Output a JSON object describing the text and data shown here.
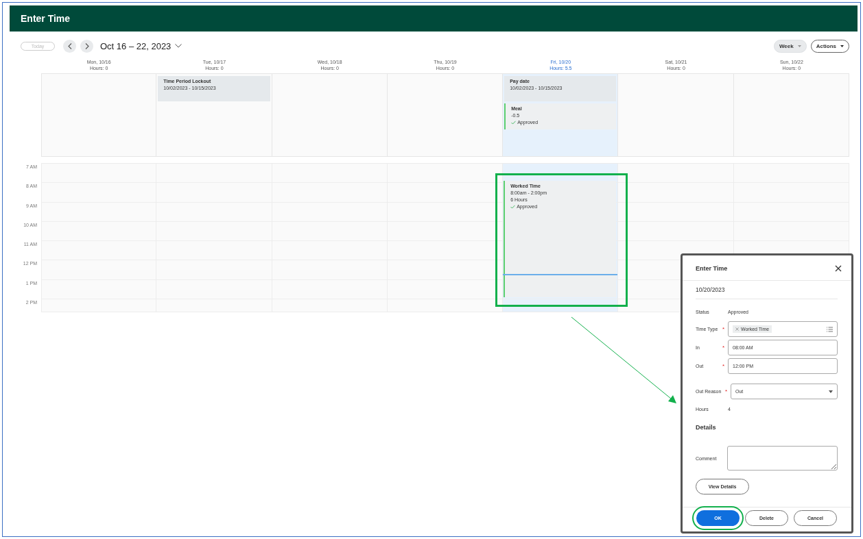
{
  "header": {
    "title": "Enter Time"
  },
  "toolbar": {
    "today": {
      "label": "Today",
      "disabled": true
    },
    "range": "Oct 16 – 22, 2023",
    "view": "Week",
    "actions": "Actions"
  },
  "days": [
    {
      "label": "Mon, 10/16",
      "hours": "Hours: 0",
      "selected": false
    },
    {
      "label": "Tue, 10/17",
      "hours": "Hours: 0",
      "selected": false,
      "all_day": [
        {
          "title": "Time Period Lockout",
          "lines": [
            "10/02/2023 - 10/15/2023"
          ],
          "approved": false
        }
      ]
    },
    {
      "label": "Wed, 10/18",
      "hours": "Hours: 0",
      "selected": false
    },
    {
      "label": "Thu, 10/19",
      "hours": "Hours: 0",
      "selected": false
    },
    {
      "label": "Fri, 10/20",
      "hours": "Hours: 5.5",
      "selected": true,
      "all_day": [
        {
          "title": "Pay date",
          "lines": [
            "10/02/2023 - 10/15/2023"
          ],
          "approved": false
        },
        {
          "title": "Meal",
          "lines": [
            "-0.5"
          ],
          "approved": true,
          "status": "Approved"
        }
      ],
      "timed": [
        {
          "title": "Worked Time",
          "lines": [
            "8:00am - 2:00pm",
            "6 Hours"
          ],
          "approved": true,
          "status": "Approved",
          "highlighted": true
        }
      ]
    },
    {
      "label": "Sat, 10/21",
      "hours": "Hours: 0",
      "selected": false
    },
    {
      "label": "Sun, 10/22",
      "hours": "Hours: 0",
      "selected": false
    }
  ],
  "hour_labels": [
    "7 AM",
    "8 AM",
    "9 AM",
    "10 AM",
    "11 AM",
    "12 PM",
    "1 PM",
    "2 PM"
  ],
  "dialog": {
    "title": "Enter Time",
    "date": "10/20/2023",
    "status": {
      "label": "Status",
      "value": "Approved"
    },
    "fields": [
      {
        "kind": "tags",
        "label": "Time Type",
        "required_mark": "*",
        "tags": [
          "Worked Time"
        ]
      },
      {
        "kind": "text",
        "label": "In",
        "required_mark": "*",
        "value": "08:00 AM"
      },
      {
        "kind": "text",
        "label": "Out",
        "required_mark": "*",
        "value": "12:00 PM"
      },
      {
        "kind": "select",
        "label": "Out Reason",
        "required_mark": "*",
        "value": "Out"
      }
    ],
    "hours": {
      "label": "Hours",
      "value": "4"
    },
    "section": "Details",
    "comment": {
      "label": "Comment"
    },
    "view_details": "View Details",
    "buttons": [
      {
        "label": "OK",
        "primary": true,
        "highlighted": true
      },
      {
        "label": "Delete",
        "primary": false,
        "highlighted": false
      },
      {
        "label": "Cancel",
        "primary": false,
        "highlighted": false
      }
    ]
  }
}
